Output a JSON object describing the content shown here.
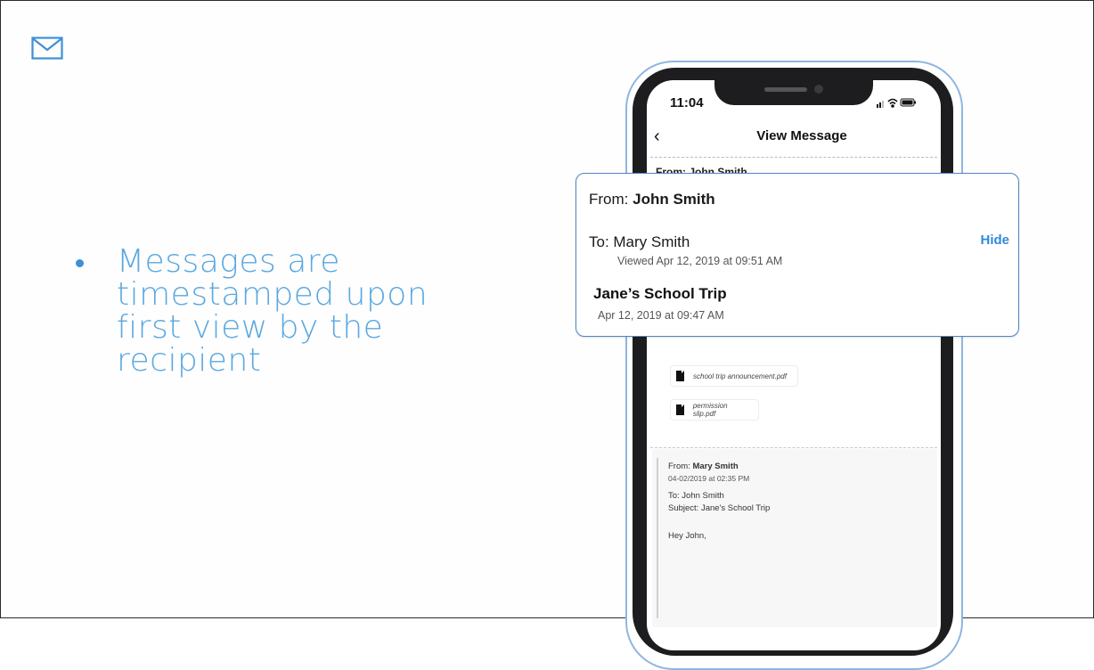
{
  "slide": {
    "bullet": "Messages are timestamped upon first view by the recipient"
  },
  "phone": {
    "status_time": "11:04",
    "nav_title": "View Message",
    "back_glyph": "‹",
    "peek_from": "From: John Smith",
    "attachments": [
      {
        "name": "school trip announcement.pdf",
        "icon": "document-icon"
      },
      {
        "name": "permission slip.pdf",
        "icon": "document-icon"
      }
    ],
    "quoted": {
      "from_label": "From:",
      "from_name": "Mary Smith",
      "date": "04-02/2019 at 02:35 PM",
      "to": "To: John Smith",
      "subject": "Subject: Jane's School Trip",
      "greeting": "Hey John,"
    }
  },
  "card": {
    "from_label": "From:",
    "from_name": "John Smith",
    "to": "To: Mary Smith",
    "hide_label": "Hide",
    "viewed": "Viewed Apr 12, 2019 at 09:51 AM",
    "subject": "Jane’s School Trip",
    "date": "Apr 12, 2019 at 09:47 AM"
  },
  "colors": {
    "accent_blue": "#2f8ad9",
    "bullet_text": "#5ba8e0",
    "card_border": "#4d86c4",
    "icon_blue": "#3f8fd6"
  },
  "icons": [
    "mail-icon",
    "back-chevron-icon",
    "signal-icon",
    "wifi-icon",
    "battery-icon",
    "document-icon"
  ]
}
